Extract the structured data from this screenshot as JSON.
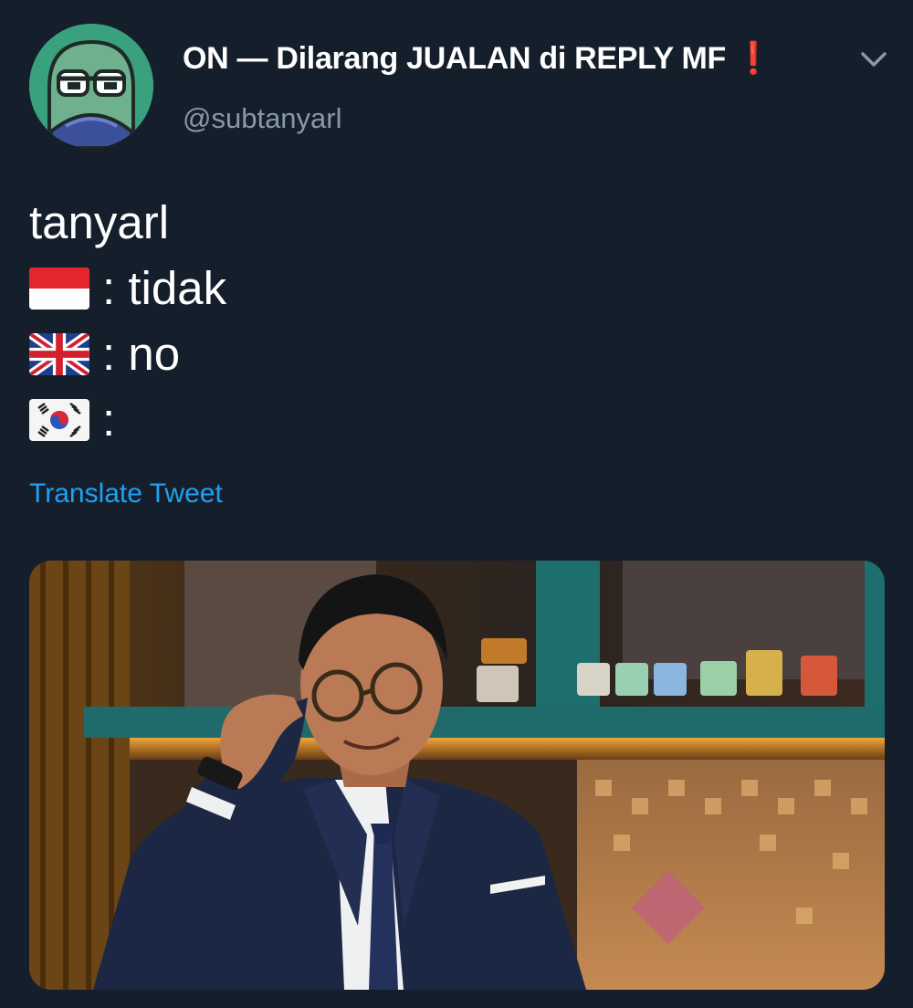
{
  "author": {
    "display_name": "ON — Dilarang JUALAN di REPLY MF",
    "emoji": "❗",
    "handle": "@subtanyarl",
    "avatar_icon": "green-cartoon-face-avatar"
  },
  "menu_icon": "chevron-down-icon",
  "tweet": {
    "lines": [
      {
        "flag": "indonesia-flag-icon",
        "text": "tanyarl"
      },
      {
        "flag": "indonesia-flag-icon",
        "text": ": tidak"
      },
      {
        "flag": "uk-flag-icon",
        "text": ": no"
      },
      {
        "flag": "south-korea-flag-icon",
        "text": ":"
      }
    ]
  },
  "translate_link": "Translate Tweet",
  "media": {
    "type": "photo",
    "subject": "man-in-navy-suit-adjusting-glasses"
  },
  "colors": {
    "background": "#151f2b",
    "text": "#ffffff",
    "muted": "#8899a6",
    "link": "#1da1f2",
    "alert": "#e0245e"
  }
}
